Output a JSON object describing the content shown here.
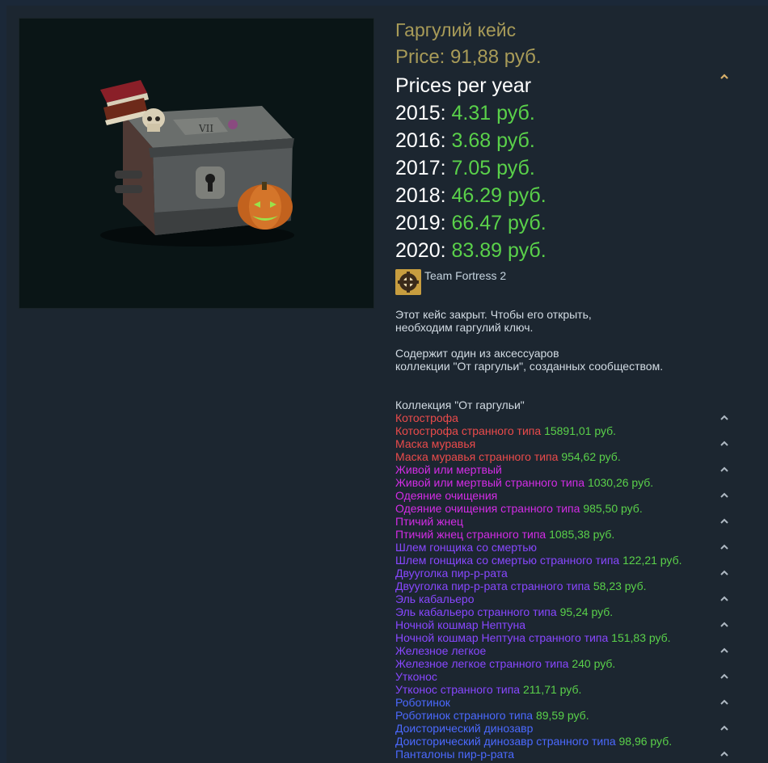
{
  "item": {
    "title": "Гаргулий кейс",
    "price": "Price: 91,88 руб."
  },
  "prices_per_year": {
    "label": "Prices per year",
    "years": [
      {
        "year": "2015:",
        "value": "4.31 руб."
      },
      {
        "year": "2016:",
        "value": "3.68 руб."
      },
      {
        "year": "2017:",
        "value": "7.05 руб."
      },
      {
        "year": "2018:",
        "value": "46.29 руб."
      },
      {
        "year": "2019:",
        "value": "66.47 руб."
      },
      {
        "year": "2020:",
        "value": "83.89 руб."
      }
    ]
  },
  "game": {
    "name": "Team Fortress 2",
    "icon": "tf2-icon"
  },
  "description": {
    "p1_line1": "Этот кейс закрыт. Чтобы его открыть,",
    "p1_line2": "необходим гаргулий ключ.",
    "p2_line1": "Содержит один из аксессуаров",
    "p2_line2": "коллекции \"От гаргульи\", созданных сообществом."
  },
  "collection": {
    "title": "Коллекция \"От гаргульи\"",
    "items": [
      {
        "name": "Котострофа",
        "strange": "Котострофа странного типа",
        "price": "15891,01 руб.",
        "color": "#eb4b4b"
      },
      {
        "name": "Маска муравья",
        "strange": "Маска муравья странного типа",
        "price": "954,62 руб.",
        "color": "#eb4b4b"
      },
      {
        "name": "Живой или мертвый",
        "strange": "Живой или мертвый странного типа",
        "price": "1030,26 руб.",
        "color": "#d32ce6"
      },
      {
        "name": "Одеяние очищения",
        "strange": "Одеяние очищения странного типа",
        "price": "985,50 руб.",
        "color": "#d32ce6"
      },
      {
        "name": "Птичий жнец",
        "strange": "Птичий жнец странного типа",
        "price": "1085,38 руб.",
        "color": "#d32ce6"
      },
      {
        "name": "Шлем гонщика со смертью",
        "strange": "Шлем гонщика со смертью странного типа",
        "price": "122,21 руб.",
        "color": "#8847ff"
      },
      {
        "name": "Двууголка пир-р-рата",
        "strange": "Двууголка пир-р-рата странного типа",
        "price": "58,23 руб.",
        "color": "#8847ff"
      },
      {
        "name": "Эль кабальеро",
        "strange": "Эль кабальеро странного типа",
        "price": "95,24 руб.",
        "color": "#8847ff"
      },
      {
        "name": "Ночной кошмар Нептуна",
        "strange": "Ночной кошмар Нептуна странного типа",
        "price": "151,83 руб.",
        "color": "#8847ff"
      },
      {
        "name": "Железное легкое",
        "strange": "Железное легкое странного типа",
        "price": "240 руб.",
        "color": "#8847ff"
      },
      {
        "name": "Утконос",
        "strange": "Утконос странного типа",
        "price": "211,71 руб.",
        "color": "#8847ff"
      },
      {
        "name": "Роботинок",
        "strange": "Роботинок странного типа",
        "price": "89,59 руб.",
        "color": "#4b69ff"
      },
      {
        "name": "Доисторический динозавр",
        "strange": "Доисторический динозавр странного типа",
        "price": "98,96 руб.",
        "color": "#4b69ff"
      },
      {
        "name": "Панталоны пир-р-рата",
        "strange": "",
        "price": "",
        "color": "#4b69ff"
      }
    ]
  },
  "colors": {
    "accent_gold": "#a89b58",
    "price_green": "#5ad14a",
    "background": "#1c2630"
  }
}
